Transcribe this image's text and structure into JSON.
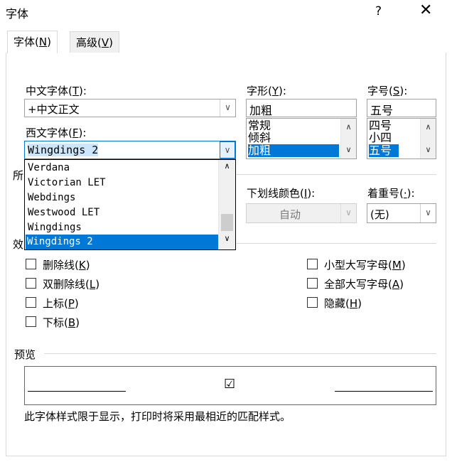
{
  "window": {
    "title": "字体",
    "help_label": "?",
    "close_label": "✕"
  },
  "tabs": [
    {
      "label": "字体",
      "key": "N",
      "active": true
    },
    {
      "label": "高级",
      "key": "V",
      "active": false
    }
  ],
  "chinese_font": {
    "label": "中文字体",
    "key": "T",
    "value": "+中文正文"
  },
  "western_font": {
    "label": "西文字体",
    "key": "F",
    "value": "Wingdings 2",
    "options": [
      "Verdana",
      "Victorian LET",
      "Webdings",
      "Westwood LET",
      "Wingdings",
      "Wingdings 2"
    ]
  },
  "style": {
    "label": "字形",
    "key": "Y",
    "value": "加粗",
    "options": [
      "常规",
      "倾斜",
      "加粗"
    ]
  },
  "size": {
    "label": "字号",
    "key": "S",
    "value": "五号",
    "options": [
      "四号",
      "小四",
      "五号"
    ]
  },
  "all_text_label_partial": "所",
  "underline_color": {
    "label": "下划线颜色",
    "key": "I",
    "value": "自动"
  },
  "emphasis": {
    "label": "着重号",
    "key": "·",
    "value": "(无)"
  },
  "effects_label_partial": "效",
  "effects_left": [
    {
      "label": "删除线",
      "key": "K"
    },
    {
      "label": "双删除线",
      "key": "L"
    },
    {
      "label": "上标",
      "key": "P"
    },
    {
      "label": "下标",
      "key": "B"
    }
  ],
  "effects_right": [
    {
      "label": "小型大写字母",
      "key": "M"
    },
    {
      "label": "全部大写字母",
      "key": "A"
    },
    {
      "label": "隐藏",
      "key": "H"
    }
  ],
  "preview": {
    "label": "预览",
    "glyph": "☑",
    "note": "此字体样式限于显示，打印时将采用最相近的匹配样式。"
  },
  "colors": {
    "selection": "#0078d7",
    "border": "#a0a0a0"
  },
  "icons": {
    "help": "question-icon",
    "close": "close-icon",
    "dropdown": "chevron-down-icon"
  }
}
